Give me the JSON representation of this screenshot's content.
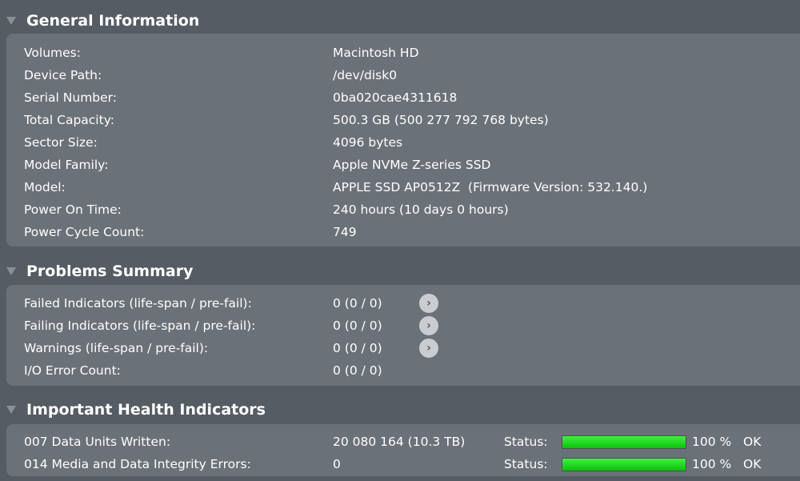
{
  "sections": {
    "general": {
      "title": "General Information",
      "rows": [
        {
          "label": "Volumes:",
          "value": "Macintosh HD"
        },
        {
          "label": "Device Path:",
          "value": "/dev/disk0"
        },
        {
          "label": "Serial Number:",
          "value": "0ba020cae4311618"
        },
        {
          "label": "Total Capacity:",
          "value": "500.3 GB (500 277 792 768 bytes)"
        },
        {
          "label": "Sector Size:",
          "value": "4096 bytes"
        },
        {
          "label": "Model Family:",
          "value": "Apple NVMe Z-series SSD"
        },
        {
          "label": "Model:",
          "value": "APPLE SSD AP0512Z  (Firmware Version: 532.140.)"
        },
        {
          "label": "Power On Time:",
          "value": "240 hours (10 days 0 hours)"
        },
        {
          "label": "Power Cycle Count:",
          "value": "749"
        }
      ]
    },
    "problems": {
      "title": "Problems Summary",
      "rows": [
        {
          "label": "Failed Indicators (life-span / pre-fail):",
          "value": "0 (0 / 0)"
        },
        {
          "label": "Failing Indicators (life-span / pre-fail):",
          "value": "0 (0 / 0)"
        },
        {
          "label": "Warnings (life-span / pre-fail):",
          "value": "0 (0 / 0)"
        },
        {
          "label": "I/O Error Count:",
          "value": "0 (0 / 0)"
        }
      ]
    },
    "health": {
      "title": "Important Health Indicators",
      "rows": [
        {
          "label": "007  Data Units Written:",
          "value": "20 080 164 (10.3 TB)",
          "status_label": "Status:",
          "percent": 100,
          "percent_text": "100 %",
          "status": "OK"
        },
        {
          "label": "014  Media and Data Integrity Errors:",
          "value": "0",
          "status_label": "Status:",
          "percent": 100,
          "percent_text": "100 %",
          "status": "OK"
        }
      ]
    }
  },
  "colors": {
    "bar": "#22dd22",
    "panel": "#6b7178",
    "background": "#565c63"
  }
}
